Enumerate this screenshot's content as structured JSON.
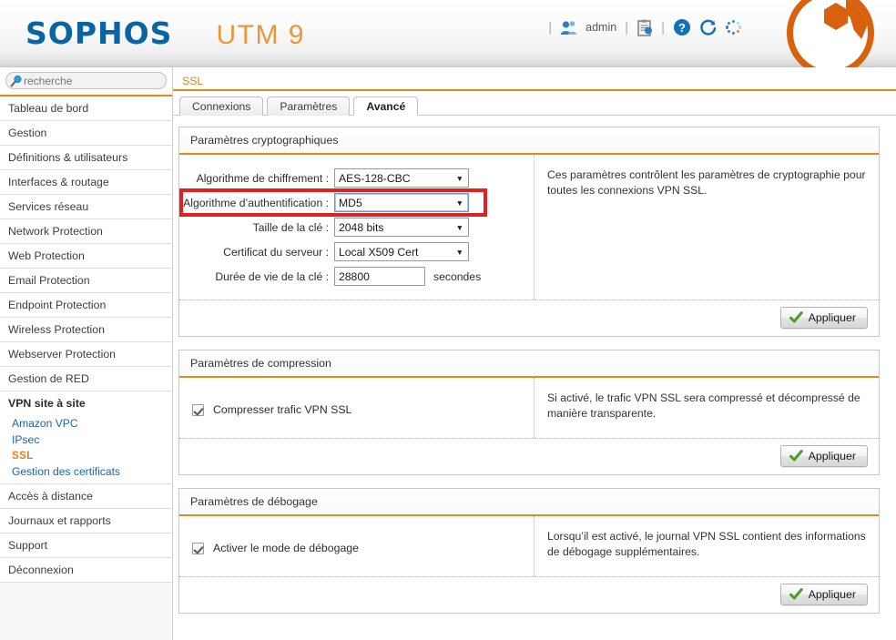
{
  "header": {
    "brand": "SOPHOS",
    "product": "UTM 9",
    "admin_label": "admin",
    "separator": "|",
    "icons": {
      "user": "user-icon",
      "clipboard": "clipboard-icon",
      "help": "help-icon",
      "reload": "reload-icon",
      "spinner": "loading-spinner-icon",
      "logo": "sophos-logo-icon"
    }
  },
  "search": {
    "placeholder": "recherche",
    "value": "",
    "icon": "search-icon"
  },
  "sidebar": {
    "items": [
      {
        "label": "Tableau de bord"
      },
      {
        "label": "Gestion"
      },
      {
        "label": "Définitions & utilisateurs"
      },
      {
        "label": "Interfaces & routage"
      },
      {
        "label": "Services réseau"
      },
      {
        "label": "Network Protection"
      },
      {
        "label": "Web Protection"
      },
      {
        "label": "Email Protection"
      },
      {
        "label": "Endpoint Protection"
      },
      {
        "label": "Wireless Protection"
      },
      {
        "label": "Webserver Protection"
      },
      {
        "label": "Gestion de RED"
      }
    ],
    "active_group": "VPN site à site",
    "subitems": [
      {
        "label": "Amazon VPC",
        "active": false
      },
      {
        "label": "IPsec",
        "active": false
      },
      {
        "label": "SSL",
        "active": true
      },
      {
        "label": "Gestion des certificats",
        "active": false
      }
    ],
    "items_after": [
      {
        "label": "Accès à distance"
      },
      {
        "label": "Journaux et rapports"
      },
      {
        "label": "Support"
      },
      {
        "label": "Déconnexion"
      }
    ]
  },
  "main": {
    "breadcrumb": "SSL",
    "tabs": [
      {
        "label": "Connexions",
        "active": false
      },
      {
        "label": "Paramètres",
        "active": false
      },
      {
        "label": "Avancé",
        "active": true
      }
    ]
  },
  "crypto_panel": {
    "title": "Paramètres cryptographiques",
    "description": "Ces paramètres contrôlent les paramètres de cryptographie pour toutes les connexions VPN SSL.",
    "apply_label": "Appliquer",
    "fields": {
      "encryption_label": "Algorithme de chiffrement :",
      "encryption_value": "AES-128-CBC",
      "auth_label": "Algorithme d’authentification :",
      "auth_value": "MD5",
      "keysize_label": "Taille de la clé :",
      "keysize_value": "2048 bits",
      "cert_label": "Certificat du serveur :",
      "cert_value": "Local X509 Cert",
      "lifetime_label": "Durée de vie de la clé :",
      "lifetime_value": "28800",
      "lifetime_unit": "secondes"
    }
  },
  "compression_panel": {
    "title": "Paramètres de compression",
    "checkbox_label": "Compresser trafic VPN SSL",
    "checkbox_checked": true,
    "description": "Si activé, le trafic VPN SSL sera compressé et décompressé de manière transparente.",
    "apply_label": "Appliquer"
  },
  "debug_panel": {
    "title": "Paramètres de débogage",
    "checkbox_label": "Activer le mode de débogage",
    "checkbox_checked": true,
    "description": "Lorsqu’il est activé, le journal VPN SSL contient des informations de débogage supplémentaires.",
    "apply_label": "Appliquer"
  },
  "colors": {
    "brand_blue": "#0a64a4",
    "accent_orange": "#e08a1e",
    "highlight_red": "#e31f1f",
    "link_blue": "#1a66a8",
    "logo_orange": "#d9600c"
  }
}
